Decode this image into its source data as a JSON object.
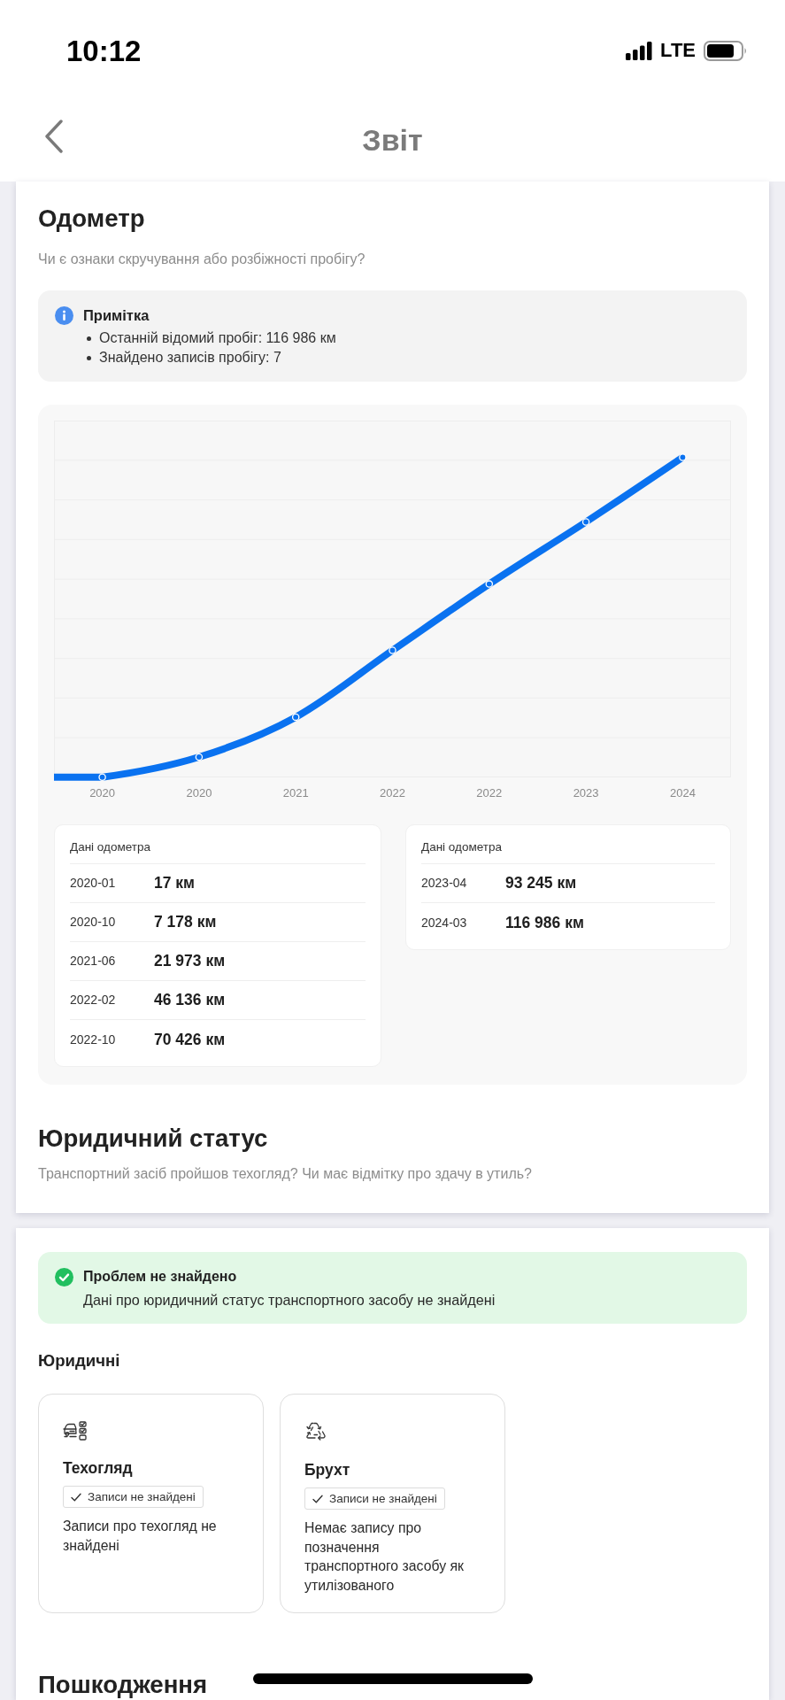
{
  "status_bar": {
    "time": "10:12",
    "network": "LTE"
  },
  "header": {
    "title": "Звіт"
  },
  "odometer": {
    "title": "Одометр",
    "subtitle": "Чи є ознаки скручування або розбіжності пробігу?",
    "note": {
      "kind": "info",
      "title": "Примітка",
      "items": [
        "Останній відомий пробіг: 116 986 км",
        "Знайдено записів пробігу: 7"
      ]
    },
    "chart": {
      "x_labels": [
        "2020",
        "2020",
        "2021",
        "2022",
        "2022",
        "2023",
        "2024"
      ]
    },
    "tables": [
      {
        "heading": "Дані одометра",
        "rows": [
          {
            "date": "2020-01",
            "mileage": "17 км"
          },
          {
            "date": "2020-10",
            "mileage": "7 178 км"
          },
          {
            "date": "2021-06",
            "mileage": "21 973 км"
          },
          {
            "date": "2022-02",
            "mileage": "46 136 км"
          },
          {
            "date": "2022-10",
            "mileage": "70 426 км"
          }
        ]
      },
      {
        "heading": "Дані одометра",
        "rows": [
          {
            "date": "2023-04",
            "mileage": "93 245 км"
          },
          {
            "date": "2024-03",
            "mileage": "116 986 км"
          }
        ]
      }
    ]
  },
  "legal_status": {
    "title": "Юридичний статус",
    "subtitle": "Транспортний засіб пройшов техогляд? Чи має відмітку про здачу в утиль?"
  },
  "legal_result": {
    "alert": {
      "kind": "success",
      "title": "Проблем не знайдено",
      "text": "Дані про юридичний статус транспортного засобу не знайдені"
    },
    "section_title": "Юридичні",
    "cards": [
      {
        "kind": "inspection",
        "title": "Техогляд",
        "badge": "Записи не знайдені",
        "text": "Записи про техогляд не знайдені"
      },
      {
        "kind": "scrap",
        "title": "Брухт",
        "badge": "Записи не знайдені",
        "text": "Немає запису про позначення транспортного засобу як утилізованого"
      }
    ]
  },
  "damage": {
    "title": "Пошкодження"
  }
}
